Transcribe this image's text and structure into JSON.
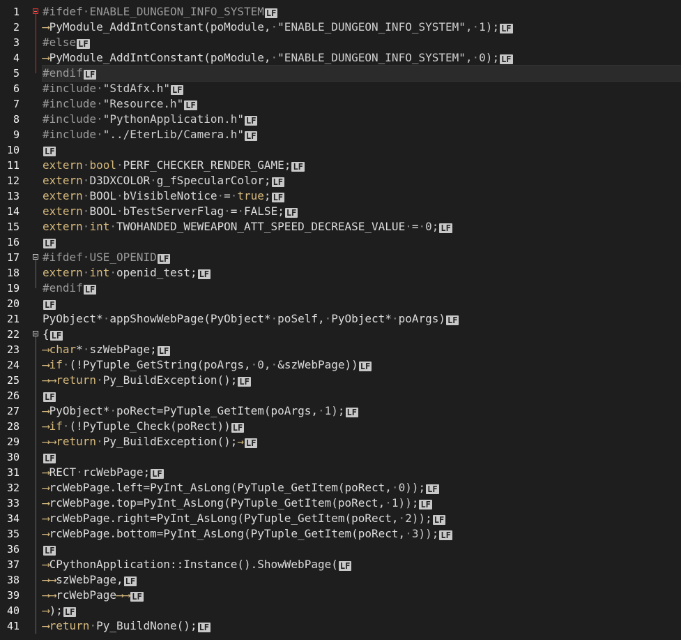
{
  "editor": {
    "line_numbers": [
      "1",
      "2",
      "3",
      "4",
      "5",
      "6",
      "7",
      "8",
      "9",
      "10",
      "11",
      "12",
      "13",
      "14",
      "15",
      "16",
      "17",
      "18",
      "19",
      "20",
      "21",
      "22",
      "23",
      "24",
      "25",
      "26",
      "27",
      "28",
      "29",
      "30",
      "31",
      "32",
      "33",
      "34",
      "35",
      "36",
      "37",
      "38",
      "39",
      "40",
      "41"
    ],
    "eol_marker": "LF",
    "current_line": 5,
    "colors": {
      "background": "#1e1e1e",
      "keyword": "#d7ba7d",
      "preprocessor": "#9b9b9b",
      "text": "#dcdcdc",
      "fold_marker_active": "#c83232"
    },
    "lines": [
      [
        [
          "pre",
          "#ifdef"
        ],
        [
          "dot",
          "·"
        ],
        [
          "pre",
          "ENABLE_DUNGEON_INFO_SYSTEM"
        ]
      ],
      [
        [
          "tab",
          "⟶"
        ],
        [
          "def",
          "PyModule_AddIntConstant(poModule,"
        ],
        [
          "dot",
          "·"
        ],
        [
          "str",
          "\"ENABLE_DUNGEON_INFO_SYSTEM\","
        ],
        [
          "dot",
          "·"
        ],
        [
          "num",
          "1);"
        ]
      ],
      [
        [
          "pre",
          "#else"
        ]
      ],
      [
        [
          "tab",
          "⟶"
        ],
        [
          "def",
          "PyModule_AddIntConstant(poModule,"
        ],
        [
          "dot",
          "·"
        ],
        [
          "str",
          "\"ENABLE_DUNGEON_INFO_SYSTEM\","
        ],
        [
          "dot",
          "·"
        ],
        [
          "num",
          "0);"
        ]
      ],
      [
        [
          "pre",
          "#endif"
        ]
      ],
      [
        [
          "pre",
          "#include"
        ],
        [
          "dot",
          "·"
        ],
        [
          "str",
          "\"StdAfx.h\""
        ]
      ],
      [
        [
          "pre",
          "#include"
        ],
        [
          "dot",
          "·"
        ],
        [
          "str",
          "\"Resource.h\""
        ]
      ],
      [
        [
          "pre",
          "#include"
        ],
        [
          "dot",
          "·"
        ],
        [
          "str",
          "\"PythonApplication.h\""
        ]
      ],
      [
        [
          "pre",
          "#include"
        ],
        [
          "dot",
          "·"
        ],
        [
          "str",
          "\"../EterLib/Camera.h\""
        ]
      ],
      [],
      [
        [
          "kw",
          "extern"
        ],
        [
          "dot",
          "·"
        ],
        [
          "kw",
          "bool"
        ],
        [
          "dot",
          "·"
        ],
        [
          "def",
          "PERF_CHECKER_RENDER_GAME;"
        ]
      ],
      [
        [
          "kw",
          "extern"
        ],
        [
          "dot",
          "·"
        ],
        [
          "def",
          "D3DXCOLOR"
        ],
        [
          "dot",
          "·"
        ],
        [
          "def",
          "g_fSpecularColor;"
        ]
      ],
      [
        [
          "kw",
          "extern"
        ],
        [
          "dot",
          "·"
        ],
        [
          "def",
          "BOOL"
        ],
        [
          "dot",
          "·"
        ],
        [
          "def",
          "bVisibleNotice"
        ],
        [
          "dot",
          "·"
        ],
        [
          "def",
          "="
        ],
        [
          "dot",
          "·"
        ],
        [
          "kw",
          "true"
        ],
        [
          "def",
          ";"
        ]
      ],
      [
        [
          "kw",
          "extern"
        ],
        [
          "dot",
          "·"
        ],
        [
          "def",
          "BOOL"
        ],
        [
          "dot",
          "·"
        ],
        [
          "def",
          "bTestServerFlag"
        ],
        [
          "dot",
          "·"
        ],
        [
          "def",
          "="
        ],
        [
          "dot",
          "·"
        ],
        [
          "def",
          "FALSE;"
        ]
      ],
      [
        [
          "kw",
          "extern"
        ],
        [
          "dot",
          "·"
        ],
        [
          "kw",
          "int"
        ],
        [
          "dot",
          "·"
        ],
        [
          "def",
          "TWOHANDED_WEWEAPON_ATT_SPEED_DECREASE_VALUE"
        ],
        [
          "dot",
          "·"
        ],
        [
          "def",
          "="
        ],
        [
          "dot",
          "·"
        ],
        [
          "num",
          "0;"
        ]
      ],
      [],
      [
        [
          "pre",
          "#ifdef"
        ],
        [
          "dot",
          "·"
        ],
        [
          "pre",
          "USE_OPENID"
        ]
      ],
      [
        [
          "kw",
          "extern"
        ],
        [
          "dot",
          "·"
        ],
        [
          "kw",
          "int"
        ],
        [
          "dot",
          "·"
        ],
        [
          "def",
          "openid_test;"
        ]
      ],
      [
        [
          "pre",
          "#endif"
        ]
      ],
      [],
      [
        [
          "def",
          "PyObject*"
        ],
        [
          "dot",
          "·"
        ],
        [
          "def",
          "appShowWebPage(PyObject*"
        ],
        [
          "dot",
          "·"
        ],
        [
          "def",
          "poSelf,"
        ],
        [
          "dot",
          "·"
        ],
        [
          "def",
          "PyObject*"
        ],
        [
          "dot",
          "·"
        ],
        [
          "def",
          "poArgs)"
        ]
      ],
      [
        [
          "def",
          "{"
        ]
      ],
      [
        [
          "tab",
          "⟶"
        ],
        [
          "kw",
          "char"
        ],
        [
          "def",
          "*"
        ],
        [
          "dot",
          "·"
        ],
        [
          "def",
          "szWebPage;"
        ]
      ],
      [
        [
          "tab",
          "⟶"
        ],
        [
          "kw",
          "if"
        ],
        [
          "dot",
          "·"
        ],
        [
          "def",
          "(!PyTuple_GetString(poArgs,"
        ],
        [
          "dot",
          "·"
        ],
        [
          "num",
          "0,"
        ],
        [
          "dot",
          "·"
        ],
        [
          "def",
          "&szWebPage))"
        ]
      ],
      [
        [
          "tab",
          "⟶⟶"
        ],
        [
          "kw",
          "return"
        ],
        [
          "dot",
          "·"
        ],
        [
          "def",
          "Py_BuildException();"
        ]
      ],
      [],
      [
        [
          "tab",
          "⟶"
        ],
        [
          "def",
          "PyObject*"
        ],
        [
          "dot",
          "·"
        ],
        [
          "def",
          "poRect=PyTuple_GetItem(poArgs,"
        ],
        [
          "dot",
          "·"
        ],
        [
          "num",
          "1);"
        ]
      ],
      [
        [
          "tab",
          "⟶"
        ],
        [
          "kw",
          "if"
        ],
        [
          "dot",
          "·"
        ],
        [
          "def",
          "(!PyTuple_Check(poRect))"
        ]
      ],
      [
        [
          "tab",
          "⟶⟶"
        ],
        [
          "kw",
          "return"
        ],
        [
          "dot",
          "·"
        ],
        [
          "def",
          "Py_BuildException();"
        ],
        [
          "tab",
          "→"
        ]
      ],
      [],
      [
        [
          "tab",
          "⟶"
        ],
        [
          "def",
          "RECT"
        ],
        [
          "dot",
          "·"
        ],
        [
          "def",
          "rcWebPage;"
        ]
      ],
      [
        [
          "tab",
          "⟶"
        ],
        [
          "def",
          "rcWebPage.left=PyInt_AsLong(PyTuple_GetItem(poRect,"
        ],
        [
          "dot",
          "·"
        ],
        [
          "num",
          "0));"
        ]
      ],
      [
        [
          "tab",
          "⟶"
        ],
        [
          "def",
          "rcWebPage.top=PyInt_AsLong(PyTuple_GetItem(poRect,"
        ],
        [
          "dot",
          "·"
        ],
        [
          "num",
          "1));"
        ]
      ],
      [
        [
          "tab",
          "⟶"
        ],
        [
          "def",
          "rcWebPage.right=PyInt_AsLong(PyTuple_GetItem(poRect,"
        ],
        [
          "dot",
          "·"
        ],
        [
          "num",
          "2));"
        ]
      ],
      [
        [
          "tab",
          "⟶"
        ],
        [
          "def",
          "rcWebPage.bottom=PyInt_AsLong(PyTuple_GetItem(poRect,"
        ],
        [
          "dot",
          "·"
        ],
        [
          "num",
          "3));"
        ]
      ],
      [],
      [
        [
          "tab",
          "⟶"
        ],
        [
          "def",
          "CPythonApplication::Instance().ShowWebPage("
        ]
      ],
      [
        [
          "tab",
          "⟶⟶"
        ],
        [
          "def",
          "szWebPage,"
        ]
      ],
      [
        [
          "tab",
          "⟶⟶"
        ],
        [
          "def",
          "rcWebPage"
        ],
        [
          "tab",
          "⟶⟶"
        ]
      ],
      [
        [
          "tab",
          "⟶"
        ],
        [
          "def",
          ");"
        ]
      ],
      [
        [
          "tab",
          "⟶"
        ],
        [
          "kw",
          "return"
        ],
        [
          "dot",
          "·"
        ],
        [
          "def",
          "Py_BuildNone();"
        ]
      ]
    ],
    "folds": [
      {
        "line": 1,
        "type": "box",
        "color": "red"
      },
      {
        "line": 2,
        "type": "line",
        "color": "red"
      },
      {
        "line": 3,
        "type": "line",
        "color": "red"
      },
      {
        "line": 4,
        "type": "line",
        "color": "red"
      },
      {
        "line": 5,
        "type": "half",
        "color": "red"
      },
      {
        "line": 17,
        "type": "box",
        "color": "grey"
      },
      {
        "line": 18,
        "type": "line",
        "color": "grey"
      },
      {
        "line": 19,
        "type": "half",
        "color": "grey"
      },
      {
        "line": 22,
        "type": "box",
        "color": "grey"
      },
      {
        "line": 23,
        "type": "line",
        "color": "grey"
      },
      {
        "line": 24,
        "type": "line",
        "color": "grey"
      },
      {
        "line": 25,
        "type": "line",
        "color": "grey"
      },
      {
        "line": 26,
        "type": "line",
        "color": "grey"
      },
      {
        "line": 27,
        "type": "line",
        "color": "grey"
      },
      {
        "line": 28,
        "type": "line",
        "color": "grey"
      },
      {
        "line": 29,
        "type": "line",
        "color": "grey"
      },
      {
        "line": 30,
        "type": "line",
        "color": "grey"
      },
      {
        "line": 31,
        "type": "line",
        "color": "grey"
      },
      {
        "line": 32,
        "type": "line",
        "color": "grey"
      },
      {
        "line": 33,
        "type": "line",
        "color": "grey"
      },
      {
        "line": 34,
        "type": "line",
        "color": "grey"
      },
      {
        "line": 35,
        "type": "line",
        "color": "grey"
      },
      {
        "line": 36,
        "type": "line",
        "color": "grey"
      },
      {
        "line": 37,
        "type": "line",
        "color": "grey"
      },
      {
        "line": 38,
        "type": "line",
        "color": "grey"
      },
      {
        "line": 39,
        "type": "line",
        "color": "grey"
      },
      {
        "line": 40,
        "type": "line",
        "color": "grey"
      },
      {
        "line": 41,
        "type": "line",
        "color": "grey"
      }
    ]
  }
}
